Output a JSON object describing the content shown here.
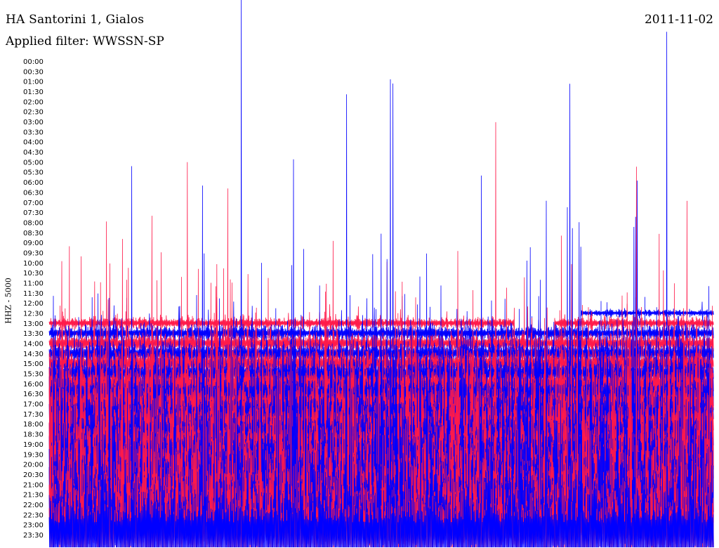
{
  "header": {
    "station": "HA Santorini 1, Gialos",
    "date": "2011-11-02",
    "filter": "Applied filter: WWSSN-SP"
  },
  "chart_data": {
    "type": "line",
    "title": "HA Santorini 1, Gialos",
    "ylabel": "HHZ - 5000",
    "row_labels": [
      "00:00",
      "00:30",
      "01:00",
      "01:30",
      "02:00",
      "02:30",
      "03:00",
      "03:30",
      "04:00",
      "04:30",
      "05:00",
      "05:30",
      "06:00",
      "06:30",
      "07:00",
      "07:30",
      "08:00",
      "08:30",
      "09:00",
      "09:30",
      "10:00",
      "10:30",
      "11:00",
      "11:30",
      "12:00",
      "12:30",
      "13:00",
      "13:30",
      "14:00",
      "14:30",
      "15:00",
      "15:30",
      "16:00",
      "16:30",
      "17:00",
      "17:30",
      "18:00",
      "18:30",
      "19:00",
      "19:30",
      "20:00",
      "20:30",
      "21:00",
      "21:30",
      "22:00",
      "22:30",
      "23:00",
      "23:30"
    ],
    "first_trace_row": "12:30",
    "row_duration_minutes": 30,
    "series": [
      {
        "name": "",
        "color": "#0000ff"
      },
      {
        "name": "",
        "color": "#ff1a4a"
      }
    ],
    "data_gap": {
      "row": "13:00",
      "start_fraction": 0.7,
      "end_fraction": 0.76
    },
    "amplitude_trend": "increasing",
    "grid": false,
    "legend": "none"
  }
}
